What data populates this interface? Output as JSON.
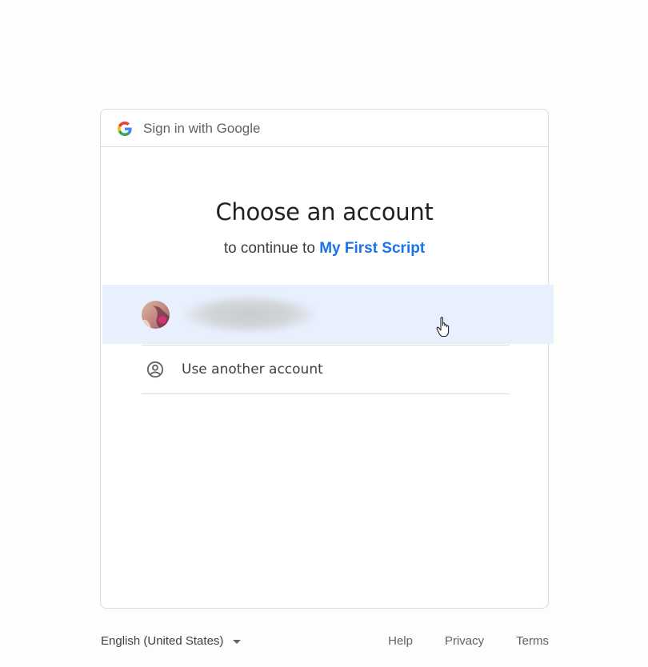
{
  "header": {
    "title": "Sign in with Google"
  },
  "main": {
    "title": "Choose an account",
    "subtitle_prefix": "to continue to",
    "app_name": "My First Script"
  },
  "accounts": [
    {
      "name": "",
      "icon": "user-avatar"
    }
  ],
  "use_another": {
    "label": "Use another account",
    "icon": "person-circle-icon"
  },
  "footer": {
    "language": "English (United States)",
    "links": [
      "Help",
      "Privacy",
      "Terms"
    ]
  },
  "colors": {
    "accent": "#1a73e8",
    "hover_row": "#e8f0fe",
    "border": "#dadce0"
  }
}
